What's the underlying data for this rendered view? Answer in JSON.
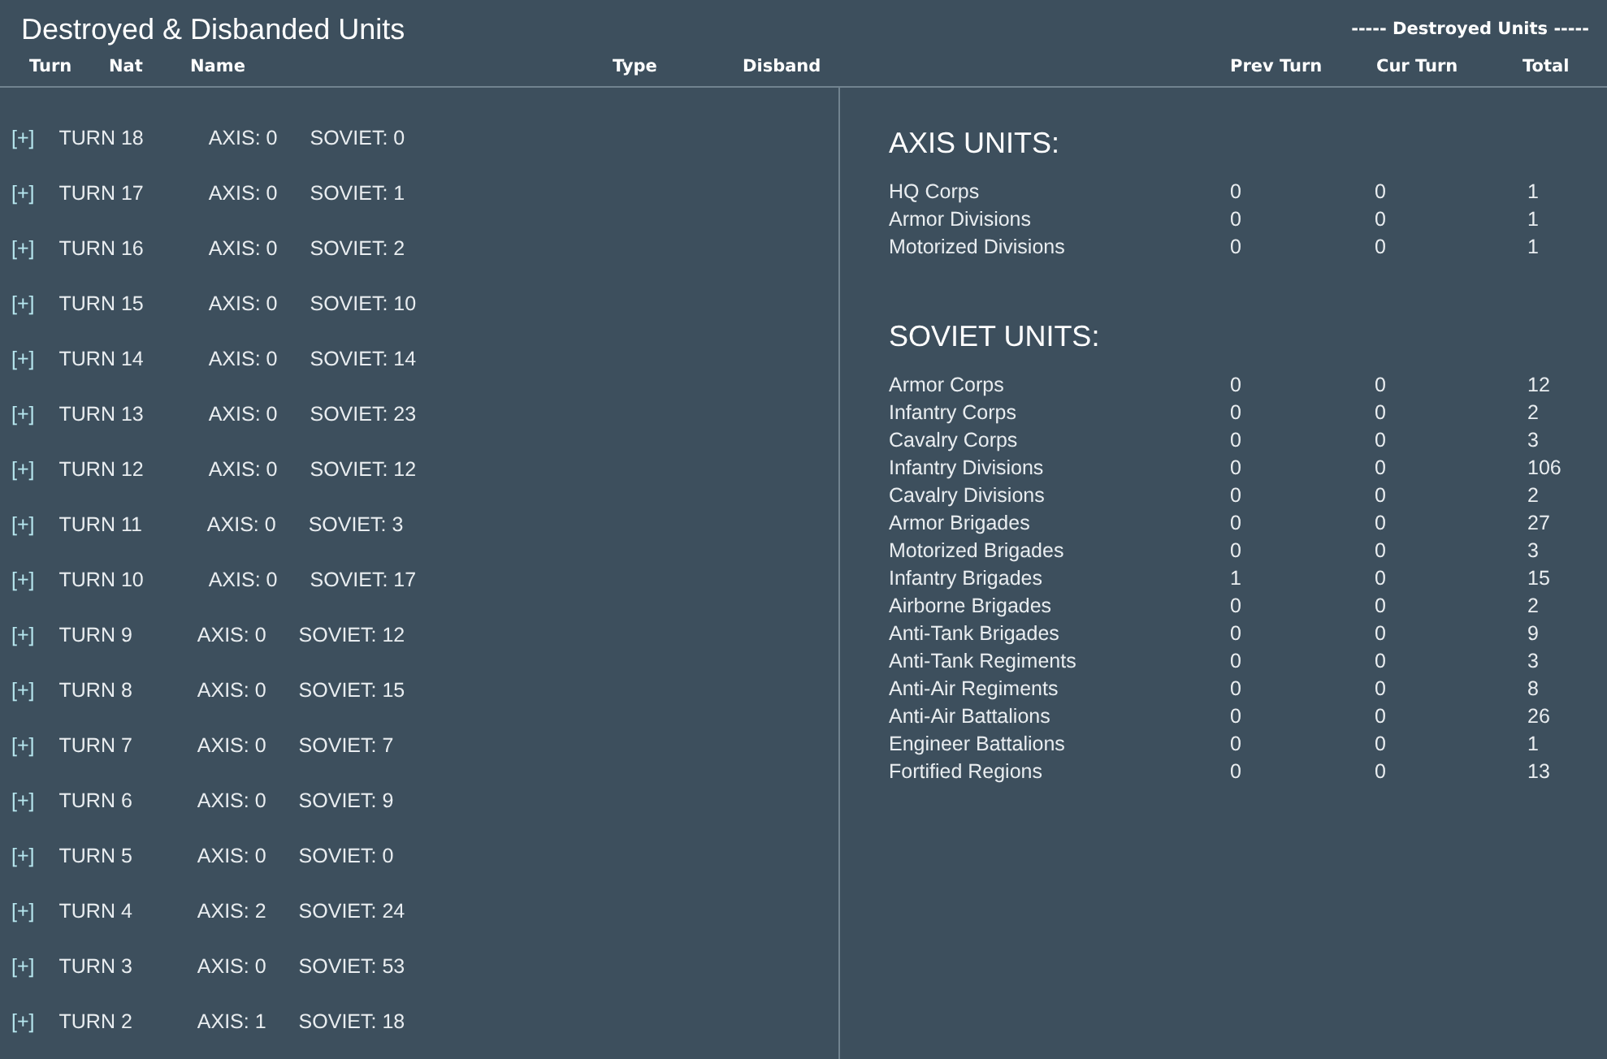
{
  "window": {
    "title": "Destroyed & Disbanded Units"
  },
  "left_columns": [
    "Turn",
    "Nat",
    "Name",
    "Type",
    "Disband"
  ],
  "right_header": {
    "group_title": "----- Destroyed Units -----",
    "columns": [
      "Prev Turn",
      "Cur Turn",
      "Total"
    ]
  },
  "turns": [
    {
      "toggle": "[+]",
      "turn": "TURN 18",
      "axis": "AXIS: 0",
      "soviet": "SOVIET: 0"
    },
    {
      "toggle": "[+]",
      "turn": "TURN 17",
      "axis": "AXIS: 0",
      "soviet": "SOVIET: 1"
    },
    {
      "toggle": "[+]",
      "turn": "TURN 16",
      "axis": "AXIS: 0",
      "soviet": "SOVIET: 2"
    },
    {
      "toggle": "[+]",
      "turn": "TURN 15",
      "axis": "AXIS: 0",
      "soviet": "SOVIET: 10"
    },
    {
      "toggle": "[+]",
      "turn": "TURN 14",
      "axis": "AXIS: 0",
      "soviet": "SOVIET: 14"
    },
    {
      "toggle": "[+]",
      "turn": "TURN 13",
      "axis": "AXIS: 0",
      "soviet": "SOVIET: 23"
    },
    {
      "toggle": "[+]",
      "turn": "TURN 12",
      "axis": "AXIS: 0",
      "soviet": "SOVIET: 12"
    },
    {
      "toggle": "[+]",
      "turn": "TURN 11",
      "axis": "AXIS: 0",
      "soviet": "SOVIET: 3"
    },
    {
      "toggle": "[+]",
      "turn": "TURN 10",
      "axis": "AXIS: 0",
      "soviet": "SOVIET: 17"
    },
    {
      "toggle": "[+]",
      "turn": "TURN 9",
      "axis": "AXIS: 0",
      "soviet": "SOVIET: 12"
    },
    {
      "toggle": "[+]",
      "turn": "TURN 8",
      "axis": "AXIS: 0",
      "soviet": "SOVIET: 15"
    },
    {
      "toggle": "[+]",
      "turn": "TURN 7",
      "axis": "AXIS: 0",
      "soviet": "SOVIET: 7"
    },
    {
      "toggle": "[+]",
      "turn": "TURN 6",
      "axis": "AXIS: 0",
      "soviet": "SOVIET: 9"
    },
    {
      "toggle": "[+]",
      "turn": "TURN 5",
      "axis": "AXIS: 0",
      "soviet": "SOVIET: 0"
    },
    {
      "toggle": "[+]",
      "turn": "TURN 4",
      "axis": "AXIS: 2",
      "soviet": "SOVIET: 24"
    },
    {
      "toggle": "[+]",
      "turn": "TURN 3",
      "axis": "AXIS: 0",
      "soviet": "SOVIET: 53"
    },
    {
      "toggle": "[+]",
      "turn": "TURN 2",
      "axis": "AXIS: 1",
      "soviet": "SOVIET: 18"
    }
  ],
  "sections": [
    {
      "title": "AXIS UNITS:",
      "rows": [
        {
          "name": "HQ Corps",
          "prev": "0",
          "cur": "0",
          "total": "1"
        },
        {
          "name": "Armor Divisions",
          "prev": "0",
          "cur": "0",
          "total": "1"
        },
        {
          "name": "Motorized Divisions",
          "prev": "0",
          "cur": "0",
          "total": "1"
        }
      ]
    },
    {
      "title": "SOVIET UNITS:",
      "rows": [
        {
          "name": "Armor Corps",
          "prev": "0",
          "cur": "0",
          "total": "12"
        },
        {
          "name": "Infantry Corps",
          "prev": "0",
          "cur": "0",
          "total": "2"
        },
        {
          "name": "Cavalry Corps",
          "prev": "0",
          "cur": "0",
          "total": "3"
        },
        {
          "name": "Infantry Divisions",
          "prev": "0",
          "cur": "0",
          "total": "106"
        },
        {
          "name": "Cavalry Divisions",
          "prev": "0",
          "cur": "0",
          "total": "2"
        },
        {
          "name": "Armor Brigades",
          "prev": "0",
          "cur": "0",
          "total": "27"
        },
        {
          "name": "Motorized Brigades",
          "prev": "0",
          "cur": "0",
          "total": "3"
        },
        {
          "name": "Infantry Brigades",
          "prev": "1",
          "cur": "0",
          "total": "15"
        },
        {
          "name": "Airborne Brigades",
          "prev": "0",
          "cur": "0",
          "total": "2"
        },
        {
          "name": "Anti-Tank Brigades",
          "prev": "0",
          "cur": "0",
          "total": "9"
        },
        {
          "name": "Anti-Tank Regiments",
          "prev": "0",
          "cur": "0",
          "total": "3"
        },
        {
          "name": "Anti-Air Regiments",
          "prev": "0",
          "cur": "0",
          "total": "8"
        },
        {
          "name": "Anti-Air Battalions",
          "prev": "0",
          "cur": "0",
          "total": "26"
        },
        {
          "name": "Engineer Battalions",
          "prev": "0",
          "cur": "0",
          "total": "1"
        },
        {
          "name": "Fortified Regions",
          "prev": "0",
          "cur": "0",
          "total": "13"
        }
      ]
    }
  ]
}
